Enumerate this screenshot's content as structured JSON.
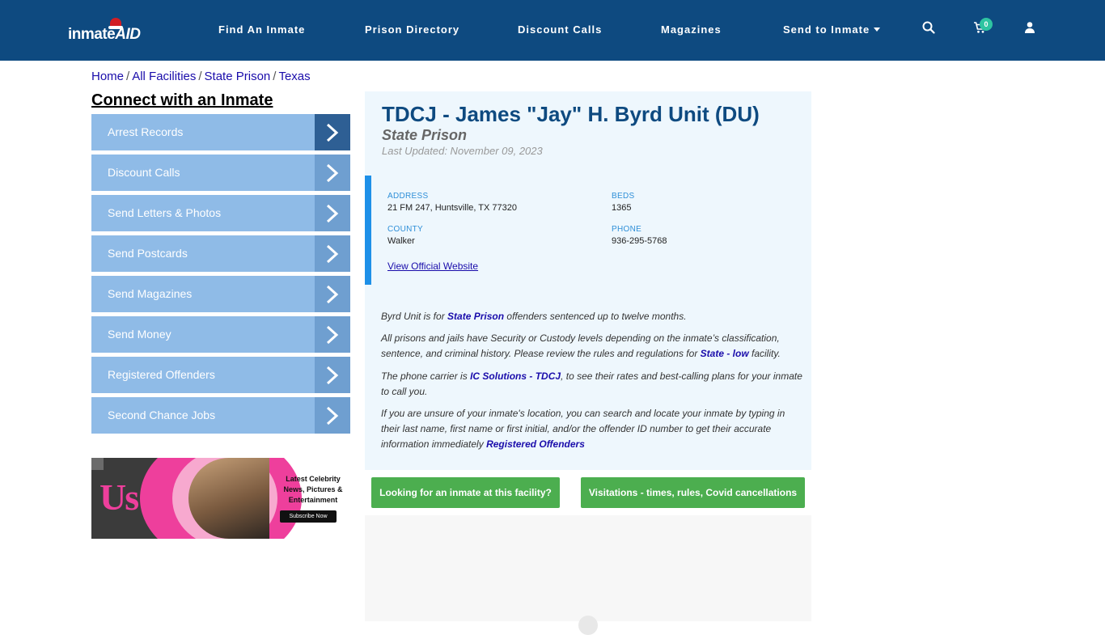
{
  "header": {
    "logo_text_main": "inmate",
    "logo_text_accent": "AID",
    "nav": [
      {
        "label": "Find An Inmate"
      },
      {
        "label": "Prison Directory"
      },
      {
        "label": "Discount Calls"
      },
      {
        "label": "Magazines"
      },
      {
        "label": "Send to Inmate"
      }
    ],
    "cart_count": "0",
    "icons": [
      "search-icon",
      "cart-icon",
      "user-icon",
      "chevron-down-icon"
    ]
  },
  "breadcrumb": {
    "items": [
      "Home",
      "All Facilities",
      "State Prison",
      "Texas"
    ],
    "separator": "/"
  },
  "sidebar": {
    "heading": "Connect with an Inmate",
    "items": [
      {
        "label": "Arrest Records"
      },
      {
        "label": "Discount Calls"
      },
      {
        "label": "Send Letters & Photos"
      },
      {
        "label": "Send Postcards"
      },
      {
        "label": "Send Magazines"
      },
      {
        "label": "Send Money"
      },
      {
        "label": "Registered Offenders"
      },
      {
        "label": "Second Chance Jobs"
      }
    ],
    "ad": {
      "brand": "Us",
      "tagline": "Latest Celebrity News, Pictures & Entertainment",
      "button": "Subscribe Now"
    }
  },
  "facility": {
    "title": "TDCJ - James \"Jay\" H. Byrd Unit (DU)",
    "type": "State Prison",
    "updated": "Last Updated: November 09, 2023",
    "address_label": "ADDRESS",
    "address": "21 FM 247, Huntsville, TX 77320",
    "beds_label": "BEDS",
    "beds": "1365",
    "county_label": "COUNTY",
    "county": "Walker",
    "phone_label": "PHONE",
    "phone": "936-295-5768",
    "website_link": "View Official Website"
  },
  "description": {
    "p1_a": "Byrd Unit is for ",
    "p1_link": "State Prison",
    "p1_b": " offenders sentenced up to twelve months.",
    "p2_a": "All prisons and jails have Security or Custody levels depending on the inmate’s classification, sentence, and criminal history. Please review the rules and regulations for ",
    "p2_link": "State - low",
    "p2_b": " facility.",
    "p3_a": "The phone carrier is ",
    "p3_link": "IC Solutions - TDCJ",
    "p3_b": ", to see their rates and best-calling plans for your inmate to call you.",
    "p4_a": "If you are unsure of your inmate's location, you can search and locate your inmate by typing in their last name, first name or first initial, and/or the offender ID number to get their accurate information immediately ",
    "p4_link": "Registered Offenders"
  },
  "buttons": {
    "inmate_search": "Looking for an inmate at this facility?",
    "visitation": "Visitations - times, rules, Covid cancellations"
  },
  "colors": {
    "header_bg": "#0e4a80",
    "sidebar_item": "#8fbbe7",
    "sidebar_arrow_active": "#2e5f94",
    "cta_green": "#4cae4f",
    "accent_blue": "#1e90e8"
  }
}
